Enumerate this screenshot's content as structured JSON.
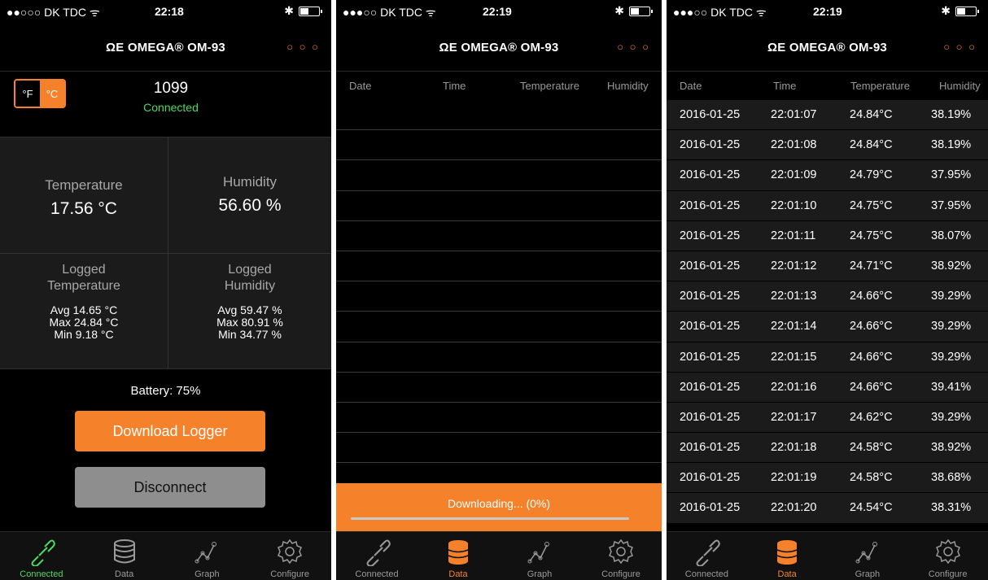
{
  "status_bar": [
    {
      "carrier": "●●○○○ DK TDC ᯤ",
      "time": "22:18",
      "bt": "✱",
      "battery_level": 0.45
    },
    {
      "carrier": "●●●○○ DK TDC ᯤ",
      "time": "22:19",
      "bt": "✱",
      "battery_level": 0.45
    },
    {
      "carrier": "●●●○○ DK TDC ᯤ",
      "time": "22:19",
      "bt": "✱",
      "battery_level": 0.45
    }
  ],
  "brand": "ΩE OMEGA® OM-93",
  "more_menu": "○ ○ ○",
  "connected_screen": {
    "unit_f": "°F",
    "unit_c": "°C",
    "selected_unit": "°C",
    "device_id": "1099",
    "status": "Connected",
    "temperature_label": "Temperature",
    "temperature_value": "17.56 °C",
    "humidity_label": "Humidity",
    "humidity_value": "56.60 %",
    "logged_temp_label_1": "Logged",
    "logged_temp_label_2": "Temperature",
    "logged_temp_avg": "Avg 14.65 °C",
    "logged_temp_max": "Max 24.84 °C",
    "logged_temp_min": "Min 9.18 °C",
    "logged_hum_label_1": "Logged",
    "logged_hum_label_2": "Humidity",
    "logged_hum_avg": "Avg 59.47 %",
    "logged_hum_max": "Max 80.91 %",
    "logged_hum_min": "Min 34.77 %",
    "battery": "Battery: 75%",
    "download_button": "Download Logger",
    "disconnect_button": "Disconnect"
  },
  "table_headers": {
    "date": "Date",
    "time": "Time",
    "temperature": "Temperature",
    "humidity": "Humidity"
  },
  "downloading_screen": {
    "progress_text": "Downloading... (0%)",
    "progress": 0.0,
    "empty_rows": 13
  },
  "data_rows": [
    {
      "date": "2016-01-25",
      "time": "22:01:07",
      "temperature": "24.84°C",
      "humidity": "38.19%"
    },
    {
      "date": "2016-01-25",
      "time": "22:01:08",
      "temperature": "24.84°C",
      "humidity": "38.19%"
    },
    {
      "date": "2016-01-25",
      "time": "22:01:09",
      "temperature": "24.79°C",
      "humidity": "37.95%"
    },
    {
      "date": "2016-01-25",
      "time": "22:01:10",
      "temperature": "24.75°C",
      "humidity": "37.95%"
    },
    {
      "date": "2016-01-25",
      "time": "22:01:11",
      "temperature": "24.75°C",
      "humidity": "38.07%"
    },
    {
      "date": "2016-01-25",
      "time": "22:01:12",
      "temperature": "24.71°C",
      "humidity": "38.92%"
    },
    {
      "date": "2016-01-25",
      "time": "22:01:13",
      "temperature": "24.66°C",
      "humidity": "39.29%"
    },
    {
      "date": "2016-01-25",
      "time": "22:01:14",
      "temperature": "24.66°C",
      "humidity": "39.29%"
    },
    {
      "date": "2016-01-25",
      "time": "22:01:15",
      "temperature": "24.66°C",
      "humidity": "39.29%"
    },
    {
      "date": "2016-01-25",
      "time": "22:01:16",
      "temperature": "24.66°C",
      "humidity": "39.41%"
    },
    {
      "date": "2016-01-25",
      "time": "22:01:17",
      "temperature": "24.62°C",
      "humidity": "39.29%"
    },
    {
      "date": "2016-01-25",
      "time": "22:01:18",
      "temperature": "24.58°C",
      "humidity": "38.92%"
    },
    {
      "date": "2016-01-25",
      "time": "22:01:19",
      "temperature": "24.58°C",
      "humidity": "38.68%"
    },
    {
      "date": "2016-01-25",
      "time": "22:01:20",
      "temperature": "24.54°C",
      "humidity": "38.31%"
    }
  ],
  "tabs": [
    {
      "label": "Connected",
      "icon": "link-icon"
    },
    {
      "label": "Data",
      "icon": "database-icon"
    },
    {
      "label": "Graph",
      "icon": "graph-icon"
    },
    {
      "label": "Configure",
      "icon": "gear-icon"
    }
  ],
  "active_tab": [
    "Connected",
    "Data",
    "Data"
  ],
  "colors": {
    "accent": "#f5822a",
    "connected": "#4cd964",
    "inactive": "#9a9a9a",
    "panel": "#1b1b1b"
  }
}
